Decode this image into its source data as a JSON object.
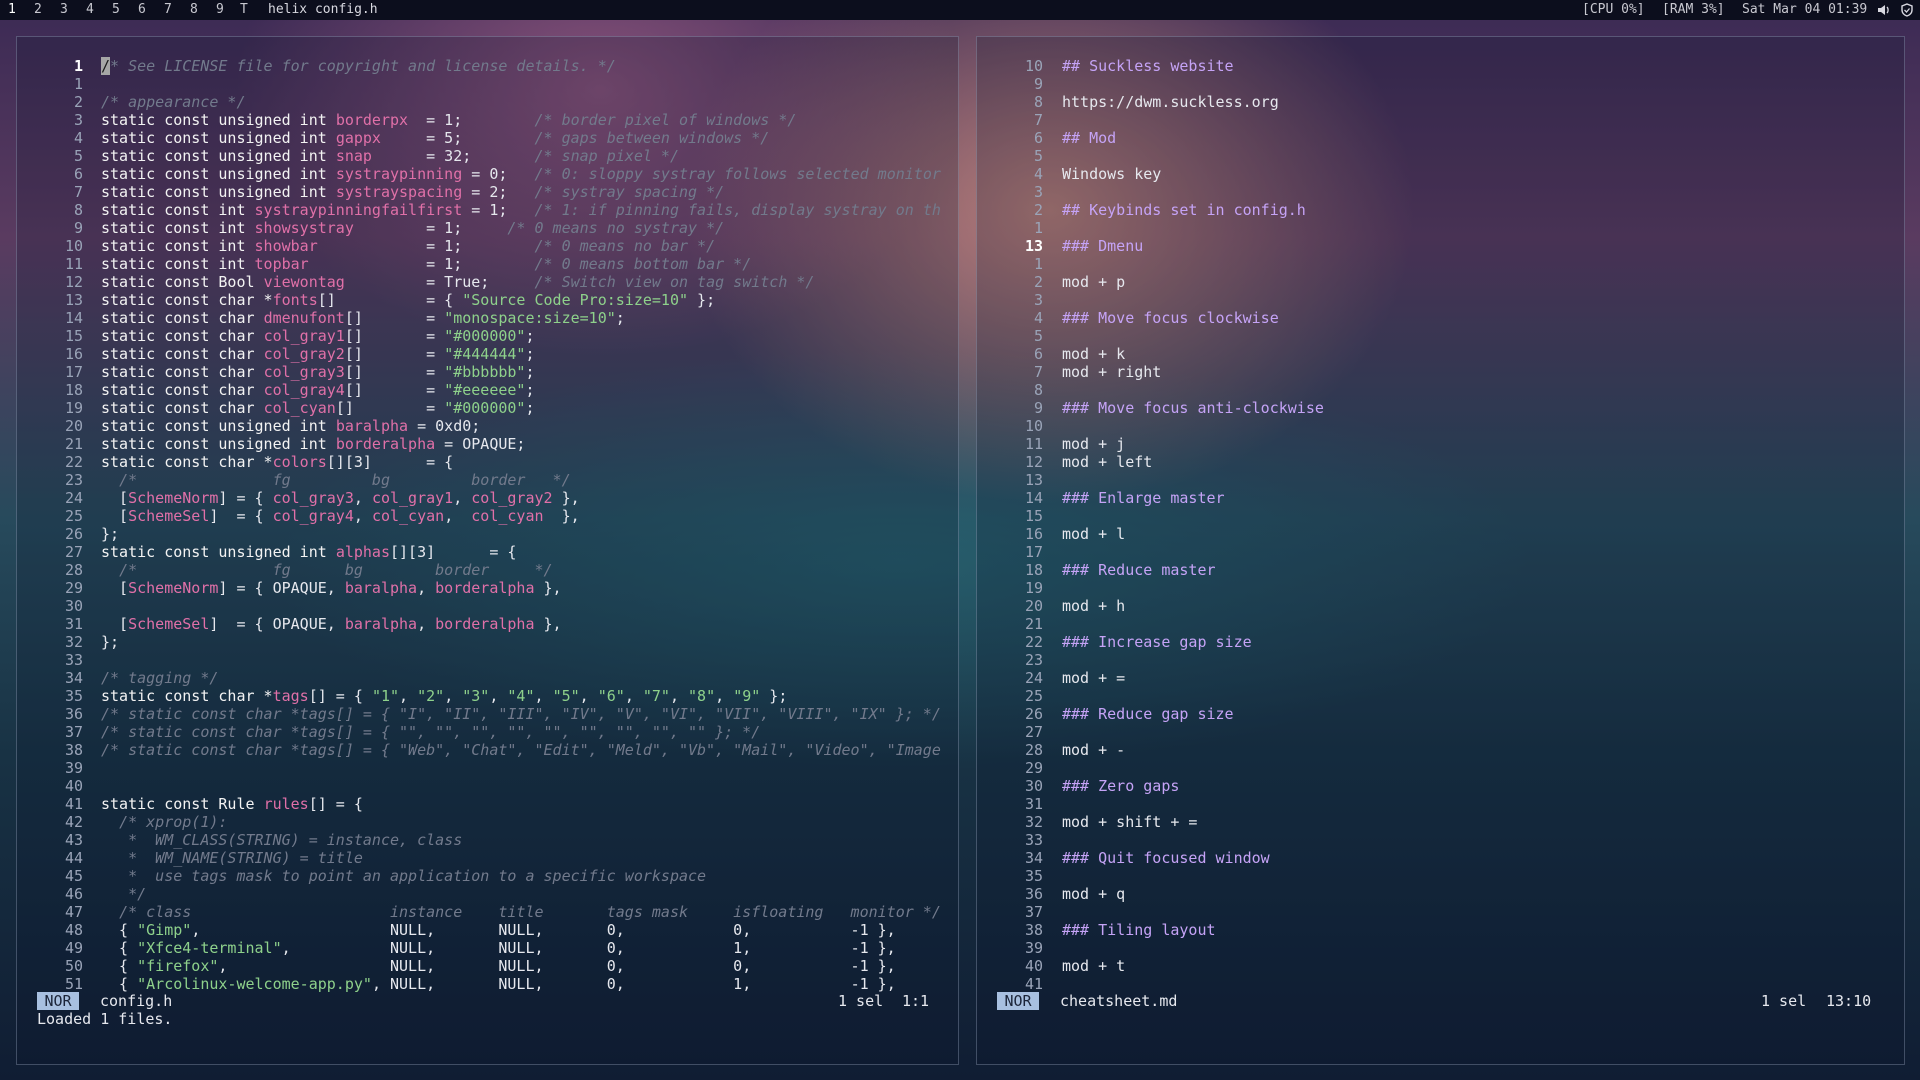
{
  "topbar": {
    "workspaces": [
      "1",
      "2",
      "3",
      "4",
      "5",
      "6",
      "7",
      "8",
      "9"
    ],
    "active_workspace": "1",
    "layout_symbol": "T",
    "window_title": "helix config.h",
    "cpu": "[CPU 0%]",
    "ram": "[RAM 3%]",
    "datetime": "Sat Mar 04 01:39",
    "tray_icons": [
      "speaker-icon",
      "shield-icon"
    ]
  },
  "left_pane": {
    "mode": "NOR",
    "filename": "config.h",
    "selection": "1 sel",
    "position": "1:1",
    "message": "Loaded 1 files.",
    "line_numbers": [
      "1",
      "1",
      "2",
      "3",
      "4",
      "5",
      "6",
      "7",
      "8",
      "9",
      "10",
      "11",
      "12",
      "13",
      "14",
      "15",
      "16",
      "17",
      "18",
      "19",
      "20",
      "21",
      "22",
      "23",
      "24",
      "25",
      "26",
      "27",
      "28",
      "29",
      "30",
      "31",
      "32",
      "33",
      "34",
      "35",
      "36",
      "37",
      "38",
      "39",
      "40",
      "41",
      "42",
      "43",
      "44",
      "45",
      "46",
      "47",
      "48",
      "49",
      "50",
      "51"
    ],
    "lines": [
      [
        {
          "t": "/",
          "c": "cursor"
        },
        {
          "t": "* See LICENSE file for copyright and license details. */",
          "c": "c"
        }
      ],
      [],
      [
        {
          "t": "/* appearance */",
          "c": "c"
        }
      ],
      [
        {
          "t": "static const unsigned int ",
          "c": "k"
        },
        {
          "t": "borderpx",
          "c": "v"
        },
        {
          "t": "  = 1;        "
        },
        {
          "t": "/* border pixel of windows */",
          "c": "c"
        }
      ],
      [
        {
          "t": "static const unsigned int ",
          "c": "k"
        },
        {
          "t": "gappx",
          "c": "v"
        },
        {
          "t": "     = 5;        "
        },
        {
          "t": "/* gaps between windows */",
          "c": "c"
        }
      ],
      [
        {
          "t": "static const unsigned int ",
          "c": "k"
        },
        {
          "t": "snap",
          "c": "v"
        },
        {
          "t": "      = 32;       "
        },
        {
          "t": "/* snap pixel */",
          "c": "c"
        }
      ],
      [
        {
          "t": "static const unsigned int ",
          "c": "k"
        },
        {
          "t": "systraypinning",
          "c": "v"
        },
        {
          "t": " = 0;   "
        },
        {
          "t": "/* 0: sloppy systray follows selected monitor",
          "c": "c"
        }
      ],
      [
        {
          "t": "static const unsigned int ",
          "c": "k"
        },
        {
          "t": "systrayspacing",
          "c": "v"
        },
        {
          "t": " = 2;   "
        },
        {
          "t": "/* systray spacing */",
          "c": "c"
        }
      ],
      [
        {
          "t": "static const int ",
          "c": "k"
        },
        {
          "t": "systraypinningfailfirst",
          "c": "v"
        },
        {
          "t": " = 1;   "
        },
        {
          "t": "/* 1: if pinning fails, display systray on th",
          "c": "c"
        }
      ],
      [
        {
          "t": "static const int ",
          "c": "k"
        },
        {
          "t": "showsystray",
          "c": "v"
        },
        {
          "t": "        = 1;     "
        },
        {
          "t": "/* 0 means no systray */",
          "c": "c"
        }
      ],
      [
        {
          "t": "static const int ",
          "c": "k"
        },
        {
          "t": "showbar",
          "c": "v"
        },
        {
          "t": "            = 1;        "
        },
        {
          "t": "/* 0 means no bar */",
          "c": "c"
        }
      ],
      [
        {
          "t": "static const int ",
          "c": "k"
        },
        {
          "t": "topbar",
          "c": "v"
        },
        {
          "t": "             = 1;        "
        },
        {
          "t": "/* 0 means bottom bar */",
          "c": "c"
        }
      ],
      [
        {
          "t": "static const Bool ",
          "c": "k"
        },
        {
          "t": "viewontag",
          "c": "v"
        },
        {
          "t": "         = True;     "
        },
        {
          "t": "/* Switch view on tag switch */",
          "c": "c"
        }
      ],
      [
        {
          "t": "static const char *",
          "c": "k"
        },
        {
          "t": "fonts",
          "c": "v"
        },
        {
          "t": "[]          = { "
        },
        {
          "t": "\"Source Code Pro:size=10\"",
          "c": "s"
        },
        {
          "t": " };"
        }
      ],
      [
        {
          "t": "static const char ",
          "c": "k"
        },
        {
          "t": "dmenufont",
          "c": "v"
        },
        {
          "t": "[]       = "
        },
        {
          "t": "\"monospace:size=10\"",
          "c": "s"
        },
        {
          "t": ";"
        }
      ],
      [
        {
          "t": "static const char ",
          "c": "k"
        },
        {
          "t": "col_gray1",
          "c": "v"
        },
        {
          "t": "[]       = "
        },
        {
          "t": "\"#000000\"",
          "c": "s"
        },
        {
          "t": ";"
        }
      ],
      [
        {
          "t": "static const char ",
          "c": "k"
        },
        {
          "t": "col_gray2",
          "c": "v"
        },
        {
          "t": "[]       = "
        },
        {
          "t": "\"#444444\"",
          "c": "s"
        },
        {
          "t": ";"
        }
      ],
      [
        {
          "t": "static const char ",
          "c": "k"
        },
        {
          "t": "col_gray3",
          "c": "v"
        },
        {
          "t": "[]       = "
        },
        {
          "t": "\"#bbbbbb\"",
          "c": "s"
        },
        {
          "t": ";"
        }
      ],
      [
        {
          "t": "static const char ",
          "c": "k"
        },
        {
          "t": "col_gray4",
          "c": "v"
        },
        {
          "t": "[]       = "
        },
        {
          "t": "\"#eeeeee\"",
          "c": "s"
        },
        {
          "t": ";"
        }
      ],
      [
        {
          "t": "static const char ",
          "c": "k"
        },
        {
          "t": "col_cyan",
          "c": "v"
        },
        {
          "t": "[]        = "
        },
        {
          "t": "\"#000000\"",
          "c": "s"
        },
        {
          "t": ";"
        }
      ],
      [
        {
          "t": "static const unsigned int ",
          "c": "k"
        },
        {
          "t": "baralpha",
          "c": "v"
        },
        {
          "t": " = 0xd0;"
        }
      ],
      [
        {
          "t": "static const unsigned int ",
          "c": "k"
        },
        {
          "t": "borderalpha",
          "c": "v"
        },
        {
          "t": " = OPAQUE;"
        }
      ],
      [
        {
          "t": "static const char *",
          "c": "k"
        },
        {
          "t": "colors",
          "c": "v"
        },
        {
          "t": "[][3]      = {"
        }
      ],
      [
        {
          "t": "  "
        },
        {
          "t": "/*               fg         bg         border   */",
          "c": "c"
        }
      ],
      [
        {
          "t": "  ["
        },
        {
          "t": "SchemeNorm",
          "c": "v"
        },
        {
          "t": "] = { "
        },
        {
          "t": "col_gray3",
          "c": "v"
        },
        {
          "t": ", "
        },
        {
          "t": "col_gray1",
          "c": "v"
        },
        {
          "t": ", "
        },
        {
          "t": "col_gray2",
          "c": "v"
        },
        {
          "t": " },"
        }
      ],
      [
        {
          "t": "  ["
        },
        {
          "t": "SchemeSel",
          "c": "v"
        },
        {
          "t": "]  = { "
        },
        {
          "t": "col_gray4",
          "c": "v"
        },
        {
          "t": ", "
        },
        {
          "t": "col_cyan",
          "c": "v"
        },
        {
          "t": ",  "
        },
        {
          "t": "col_cyan",
          "c": "v"
        },
        {
          "t": "  },"
        }
      ],
      [
        {
          "t": "};"
        }
      ],
      [
        {
          "t": "static const unsigned int ",
          "c": "k"
        },
        {
          "t": "alphas",
          "c": "v"
        },
        {
          "t": "[][3]      = {"
        }
      ],
      [
        {
          "t": "  "
        },
        {
          "t": "/*               fg      bg        border     */",
          "c": "c"
        }
      ],
      [
        {
          "t": "  ["
        },
        {
          "t": "SchemeNorm",
          "c": "v"
        },
        {
          "t": "] = { OPAQUE, "
        },
        {
          "t": "baralpha",
          "c": "v"
        },
        {
          "t": ", "
        },
        {
          "t": "borderalpha",
          "c": "v"
        },
        {
          "t": " },"
        }
      ],
      [],
      [
        {
          "t": "  ["
        },
        {
          "t": "SchemeSel",
          "c": "v"
        },
        {
          "t": "]  = { OPAQUE, "
        },
        {
          "t": "baralpha",
          "c": "v"
        },
        {
          "t": ", "
        },
        {
          "t": "borderalpha",
          "c": "v"
        },
        {
          "t": " },"
        }
      ],
      [
        {
          "t": "};"
        }
      ],
      [],
      [
        {
          "t": "/* tagging */",
          "c": "c"
        }
      ],
      [
        {
          "t": "static const char *",
          "c": "k"
        },
        {
          "t": "tags",
          "c": "v"
        },
        {
          "t": "[] = { "
        },
        {
          "t": "\"1\"",
          "c": "s"
        },
        {
          "t": ", "
        },
        {
          "t": "\"2\"",
          "c": "s"
        },
        {
          "t": ", "
        },
        {
          "t": "\"3\"",
          "c": "s"
        },
        {
          "t": ", "
        },
        {
          "t": "\"4\"",
          "c": "s"
        },
        {
          "t": ", "
        },
        {
          "t": "\"5\"",
          "c": "s"
        },
        {
          "t": ", "
        },
        {
          "t": "\"6\"",
          "c": "s"
        },
        {
          "t": ", "
        },
        {
          "t": "\"7\"",
          "c": "s"
        },
        {
          "t": ", "
        },
        {
          "t": "\"8\"",
          "c": "s"
        },
        {
          "t": ", "
        },
        {
          "t": "\"9\"",
          "c": "s"
        },
        {
          "t": " };"
        }
      ],
      [
        {
          "t": "/* static const char *tags[] = { \"I\", \"II\", \"III\", \"IV\", \"V\", \"VI\", \"VII\", \"VIII\", \"IX\" }; */",
          "c": "c"
        }
      ],
      [
        {
          "t": "/* static const char *tags[] = { \"\", \"\", \"\", \"\", \"\", \"\", \"\", \"\", \"\" }; */",
          "c": "c"
        }
      ],
      [
        {
          "t": "/* static const char *tags[] = { \"Web\", \"Chat\", \"Edit\", \"Meld\", \"Vb\", \"Mail\", \"Video\", \"Image",
          "c": "c"
        }
      ],
      [],
      [],
      [
        {
          "t": "static const Rule ",
          "c": "k"
        },
        {
          "t": "rules",
          "c": "v"
        },
        {
          "t": "[] = {"
        }
      ],
      [
        {
          "t": "  "
        },
        {
          "t": "/* xprop(1):",
          "c": "c"
        }
      ],
      [
        {
          "t": "  "
        },
        {
          "t": " *  WM_CLASS(STRING) = instance, class",
          "c": "c"
        }
      ],
      [
        {
          "t": "  "
        },
        {
          "t": " *  WM_NAME(STRING) = title",
          "c": "c"
        }
      ],
      [
        {
          "t": "  "
        },
        {
          "t": " *  use tags mask to point an application to a specific workspace",
          "c": "c"
        }
      ],
      [
        {
          "t": "  "
        },
        {
          "t": " */",
          "c": "c"
        }
      ],
      [
        {
          "t": "  "
        },
        {
          "t": "/* class                      instance    title       tags mask     isfloating   monitor */",
          "c": "c"
        }
      ],
      [
        {
          "t": "  { "
        },
        {
          "t": "\"Gimp\"",
          "c": "s"
        },
        {
          "t": ",                     NULL,       NULL,       0,            0,           -1 },"
        }
      ],
      [
        {
          "t": "  { "
        },
        {
          "t": "\"Xfce4-terminal\"",
          "c": "s"
        },
        {
          "t": ",           NULL,       NULL,       0,            1,           -1 },"
        }
      ],
      [
        {
          "t": "  { "
        },
        {
          "t": "\"firefox\"",
          "c": "s"
        },
        {
          "t": ",                  NULL,       NULL,       0,            0,           -1 },"
        }
      ],
      [
        {
          "t": "  { "
        },
        {
          "t": "\"Arcolinux-welcome-app.py\"",
          "c": "s"
        },
        {
          "t": ", NULL,       NULL,       0,            1,           -1 },"
        }
      ]
    ]
  },
  "right_pane": {
    "mode": "NOR",
    "filename": "cheatsheet.md",
    "selection": "1 sel",
    "position": "13:10",
    "line_numbers": [
      "10",
      "9",
      "8",
      "7",
      "6",
      "5",
      "4",
      "3",
      "2",
      "1",
      "13",
      "1",
      "2",
      "3",
      "4",
      "5",
      "6",
      "7",
      "8",
      "9",
      "10",
      "11",
      "12",
      "13",
      "14",
      "15",
      "16",
      "17",
      "18",
      "19",
      "20",
      "21",
      "22",
      "23",
      "24",
      "25",
      "26",
      "27",
      "28",
      "29",
      "30",
      "31",
      "32",
      "33",
      "34",
      "35",
      "36",
      "37",
      "38",
      "39",
      "40",
      "41"
    ],
    "lines": [
      [
        {
          "t": "## Suckless website",
          "c": "h"
        }
      ],
      [],
      [
        {
          "t": "https://dwm.suckless.org"
        }
      ],
      [],
      [
        {
          "t": "## Mod",
          "c": "h"
        }
      ],
      [],
      [
        {
          "t": "Windows key"
        }
      ],
      [],
      [
        {
          "t": "## Keybinds set in config.h",
          "c": "h"
        }
      ],
      [],
      [
        {
          "t": "### Dmenu",
          "c": "h"
        }
      ],
      [],
      [
        {
          "t": "mod + p"
        }
      ],
      [],
      [
        {
          "t": "### Move focus clockwise",
          "c": "h"
        }
      ],
      [],
      [
        {
          "t": "mod + k"
        }
      ],
      [
        {
          "t": "mod + right"
        }
      ],
      [],
      [
        {
          "t": "### Move focus anti-clockwise",
          "c": "h"
        }
      ],
      [],
      [
        {
          "t": "mod + j"
        }
      ],
      [
        {
          "t": "mod + left"
        }
      ],
      [],
      [
        {
          "t": "### Enlarge master",
          "c": "h"
        }
      ],
      [],
      [
        {
          "t": "mod + l"
        }
      ],
      [],
      [
        {
          "t": "### Reduce master",
          "c": "h"
        }
      ],
      [],
      [
        {
          "t": "mod + h"
        }
      ],
      [],
      [
        {
          "t": "### Increase gap size",
          "c": "h"
        }
      ],
      [],
      [
        {
          "t": "mod + ="
        }
      ],
      [],
      [
        {
          "t": "### Reduce gap size",
          "c": "h"
        }
      ],
      [],
      [
        {
          "t": "mod + -"
        }
      ],
      [],
      [
        {
          "t": "### Zero gaps",
          "c": "h"
        }
      ],
      [],
      [
        {
          "t": "mod + shift + ="
        }
      ],
      [],
      [
        {
          "t": "### Quit focused window",
          "c": "h"
        }
      ],
      [],
      [
        {
          "t": "mod + q"
        }
      ],
      [],
      [
        {
          "t": "### Tiling layout",
          "c": "h"
        }
      ],
      [],
      [
        {
          "t": "mod + t"
        }
      ],
      []
    ]
  },
  "colors": {
    "comment": "#727a8c",
    "string": "#8ed18b",
    "identifier": "#e070a8",
    "markdown_heading": "#c5a3f6",
    "mode_badge_bg": "#a8c0e0",
    "bar_bg": "#0c0e1d"
  }
}
